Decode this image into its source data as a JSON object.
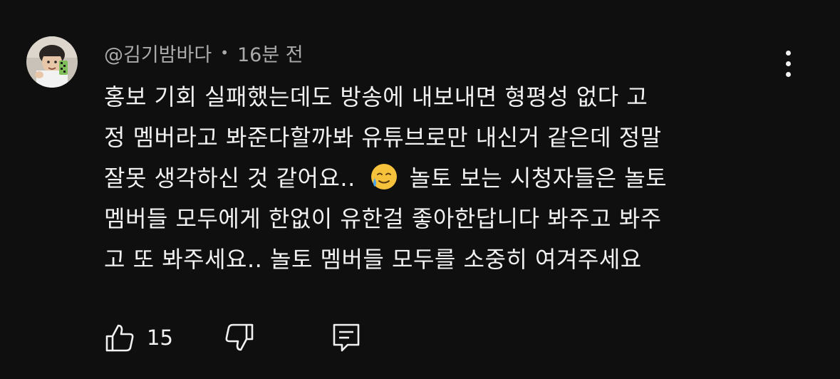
{
  "comment": {
    "author": "@김기밤바다",
    "separator": "•",
    "time": "16분 전",
    "text_lines": [
      "홍보 기회 실패했는데도 방송에 내보내면 형평성 없다 고",
      "정 멤버라고 봐준다할까봐 유튜브로만 내신거 같은데 정말",
      "잘못 생각하신 것 같어요..",
      "놀토 보는 시청자들은 놀토",
      "멤버들 모두에게 한없이 유한걸 좋아한답니다 봐주고 봐주",
      "고 또 봐주세요.. 놀토 멤버들 모두를 소중히 여겨주세요"
    ],
    "emoji": "sad-but-relieved-face",
    "like_count": "15"
  },
  "icons": {
    "more": "more-vertical-icon",
    "like": "thumbs-up-icon",
    "dislike": "thumbs-down-icon",
    "reply": "reply-comment-icon"
  },
  "colors": {
    "background": "#0f0f0f",
    "text_primary": "#f1f1f1",
    "text_secondary": "#aaaaaa",
    "emoji_face": "#f7c23b",
    "emoji_tear": "#4aa3e8"
  }
}
